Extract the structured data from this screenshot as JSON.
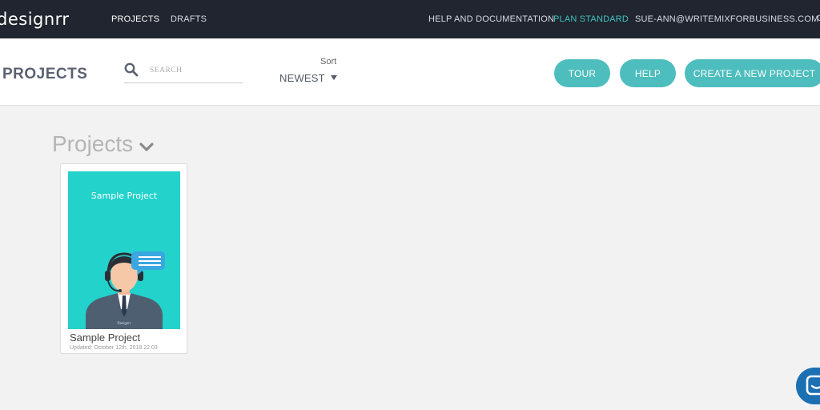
{
  "nav": {
    "logo_text": "designrr",
    "links": {
      "projects": "PROJECTS",
      "drafts": "DRAFTS",
      "help_docs": "HELP AND DOCUMENTATION",
      "plan": "PLAN STANDARD",
      "account": "SUE-ANN@WRITEMIXFORBUSINESS.COM"
    },
    "edge_glyph": "C"
  },
  "header": {
    "title": "PROJECTS",
    "search": {
      "placeholder": "SEARCH",
      "value": ""
    },
    "sort": {
      "label": "Sort",
      "selected": "NEWEST"
    },
    "buttons": {
      "tour": "TOUR",
      "help": "HELP",
      "create": "CREATE A NEW PROJECT"
    }
  },
  "main": {
    "section_title": "Projects",
    "projects": [
      {
        "thumbnail_title": "Sample Project",
        "thumbnail_caption": "Designrr",
        "name": "Sample Project",
        "updated": "Updated: October 12th, 2018 22:03"
      }
    ]
  },
  "colors": {
    "nav_bg": "#20252f",
    "accent": "#4dbdbd",
    "plan_link": "#3fc3c0",
    "thumbnail_bg": "#22d2cb",
    "chat_widget": "#1b6fb3"
  }
}
